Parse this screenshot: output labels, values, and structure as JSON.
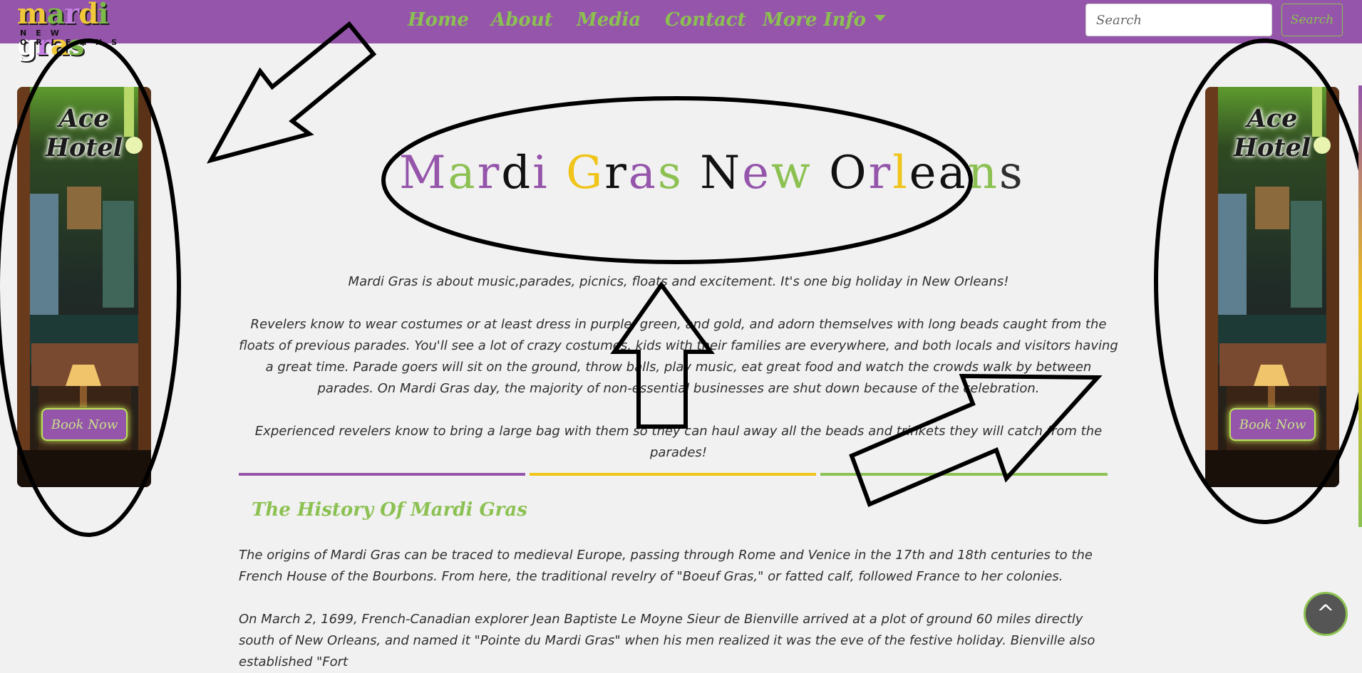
{
  "logo": {
    "letters": [
      "m",
      "a",
      "r",
      "d",
      "i",
      " ",
      "g",
      "r",
      "a",
      "s"
    ],
    "sub": "NEW ORLEANS"
  },
  "nav": {
    "items": [
      "Home",
      "About",
      "Media",
      "Contact",
      "More Info"
    ],
    "search_placeholder": "Search",
    "search_button": "Search"
  },
  "ads": {
    "left": {
      "title": "Ace Hotel",
      "button": "Book Now"
    },
    "right": {
      "title": "Ace Hotel",
      "button": "Book Now"
    }
  },
  "main": {
    "title": "Mardi Gras New Orleans",
    "paragraphs": [
      "Mardi Gras is about music,parades, picnics, floats and excitement. It's one big holiday in New Orleans!",
      "Revelers know to wear costumes or at least dress in purple, green, and gold, and adorn themselves with long beads caught from the floats of previous parades. You'll see a lot of crazy costumes, kids with their families are everywhere, and both locals and visitors having a great time. Parade goers will sit on the ground, throw balls, play music, eat great food and watch the crowds walk by between parades. On Mardi Gras day, the majority of non-essential businesses are shut down because of the celebration.",
      "Experienced revelers know to bring a large bag with them so they can haul away all the beads and trinkets they will catch from the parades!"
    ],
    "history_heading": "The History Of Mardi Gras",
    "history_paragraphs": [
      "The origins of Mardi Gras can be traced to medieval Europe, passing through Rome and Venice in the 17th and 18th centuries to the French House of the Bourbons. From here, the traditional revelry of \"Boeuf Gras,\" or fatted calf, followed France to her colonies.",
      "On March 2, 1699, French-Canadian explorer Jean Baptiste Le Moyne Sieur de Bienville arrived at a plot of ground 60 miles directly south of New Orleans, and named it \"Pointe du Mardi Gras\" when his men realized it was the eve of the festive holiday. Bienville also established \"Fort"
    ]
  },
  "back_to_top": "^",
  "colors": {
    "purple": "#9555ab",
    "gold": "#f0c419",
    "green": "#8cc152"
  }
}
